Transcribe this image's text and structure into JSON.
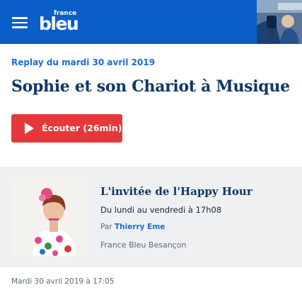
{
  "header": {
    "logo_top": "france",
    "logo_main": "bleu",
    "menu_icon": "hamburger-icon",
    "colors": {
      "background": "#0a5ec8"
    }
  },
  "episode": {
    "replay_label": "Replay du mardi 30 avril 2019",
    "title": "Sophie et son Chariot à Musique",
    "listen_button": "Écouter (26min)",
    "listen_icon": "play-icon",
    "colors": {
      "accent": "#1b6bd1",
      "title": "#0f3765",
      "button": "#e5383b"
    }
  },
  "show": {
    "title": "L'invitée de l'Happy Hour",
    "schedule": "Du lundi au vendredi à 17h08",
    "by_prefix": "Par",
    "presenter": "Thierry Eme",
    "station": "France Bleu Besançon"
  },
  "footer": {
    "date": "Mardi 30 avril 2019 à 17:05"
  }
}
